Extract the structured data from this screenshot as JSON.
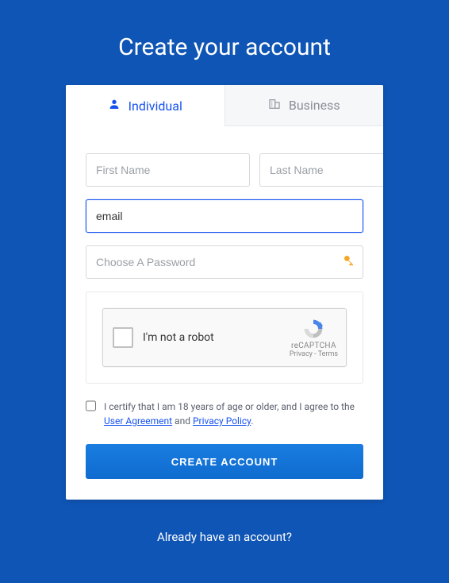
{
  "header": {
    "title": "Create your account"
  },
  "tabs": {
    "individual": "Individual",
    "business": "Business"
  },
  "form": {
    "first_name_placeholder": "First Name",
    "first_name_value": "",
    "last_name_placeholder": "Last Name",
    "last_name_value": "",
    "email_placeholder": "Email",
    "email_value": "email",
    "password_placeholder": "Choose A Password",
    "password_value": ""
  },
  "captcha": {
    "label": "I'm not a robot",
    "brand": "reCAPTCHA",
    "privacy": "Privacy",
    "terms": "Terms"
  },
  "certify": {
    "prefix": "I certify that I am 18 years of age or older, and I agree to the ",
    "agreement_link": "User Agreement",
    "middle": " and ",
    "privacy_link": "Privacy Policy",
    "suffix": "."
  },
  "submit_label": "CREATE ACCOUNT",
  "footer": {
    "already": "Already have an account?"
  }
}
